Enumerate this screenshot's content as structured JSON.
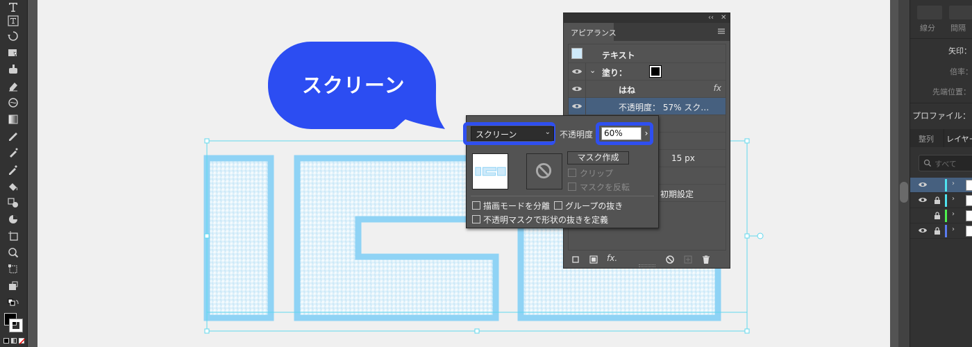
{
  "toolbar": {
    "tools": [
      "type-tool",
      "area-type-tool",
      "rotate-tool",
      "shape-builder-tool",
      "live-paint-tool",
      "eraser-tool",
      "warp-tool",
      "gradient-tool",
      "blend-tool",
      "symbol-sprayer-tool",
      "eyedropper-tool",
      "live-paint-bucket-tool",
      "perspective-tool",
      "pie-graph-tool",
      "artboard-tool",
      "zoom-tool",
      "free-transform-tool",
      "puppet-warp-tool"
    ],
    "fill_color": "#000000",
    "stroke_color": "#ffffff"
  },
  "bubble": {
    "text": "スクリーン",
    "color": "#2c4df2"
  },
  "properties_panel": {
    "stroke_tabs": [
      "線分",
      "間隔"
    ],
    "arrowhead_label": "矢印：",
    "scale_label": "倍率：",
    "align_label": "先端位置：",
    "profile_label": "プロファイル："
  },
  "layers_panel": {
    "tabs": [
      "整列",
      "レイヤー"
    ],
    "search_placeholder": "すべて",
    "rows": [
      {
        "visible": true,
        "locked": false,
        "color": "#4fe3f0",
        "selected": true
      },
      {
        "visible": true,
        "locked": true,
        "color": "#4fe3f0",
        "selected": false
      },
      {
        "visible": false,
        "locked": true,
        "color": "#4ef04e",
        "selected": false
      },
      {
        "visible": true,
        "locked": true,
        "color": "#5a7cf0",
        "selected": false
      }
    ]
  },
  "appearance_panel": {
    "tab_label": "アピアランス",
    "rows": {
      "object_type": "テキスト",
      "fill_label": "塗り：",
      "effect_name": "はね",
      "fx_badge": "fx",
      "opacity_row": "不透明度： 57% スク…",
      "stroke_width": "15 px",
      "defaults_label": "初期設定"
    },
    "bottom_icons": [
      "new-art-basic-icon",
      "clear-appearance-square-icon",
      "fx-menu-icon",
      "clear-icon",
      "duplicate-item-icon",
      "delete-icon"
    ],
    "fx_bottom_label": "fx."
  },
  "transparency_popup": {
    "blend_mode": "スクリーン",
    "opacity_label": "不透明度",
    "opacity_value": "60%",
    "make_mask_label": "マスク作成",
    "clip_label": "クリップ",
    "invert_mask_label": "マスクを反転",
    "isolate_blending_label": "描画モードを分離",
    "knockout_group_label": "グループの抜き",
    "opacity_mask_knockout_label": "不透明マスクで形状の抜きを定義",
    "highlight_color": "#2f4ff0"
  }
}
